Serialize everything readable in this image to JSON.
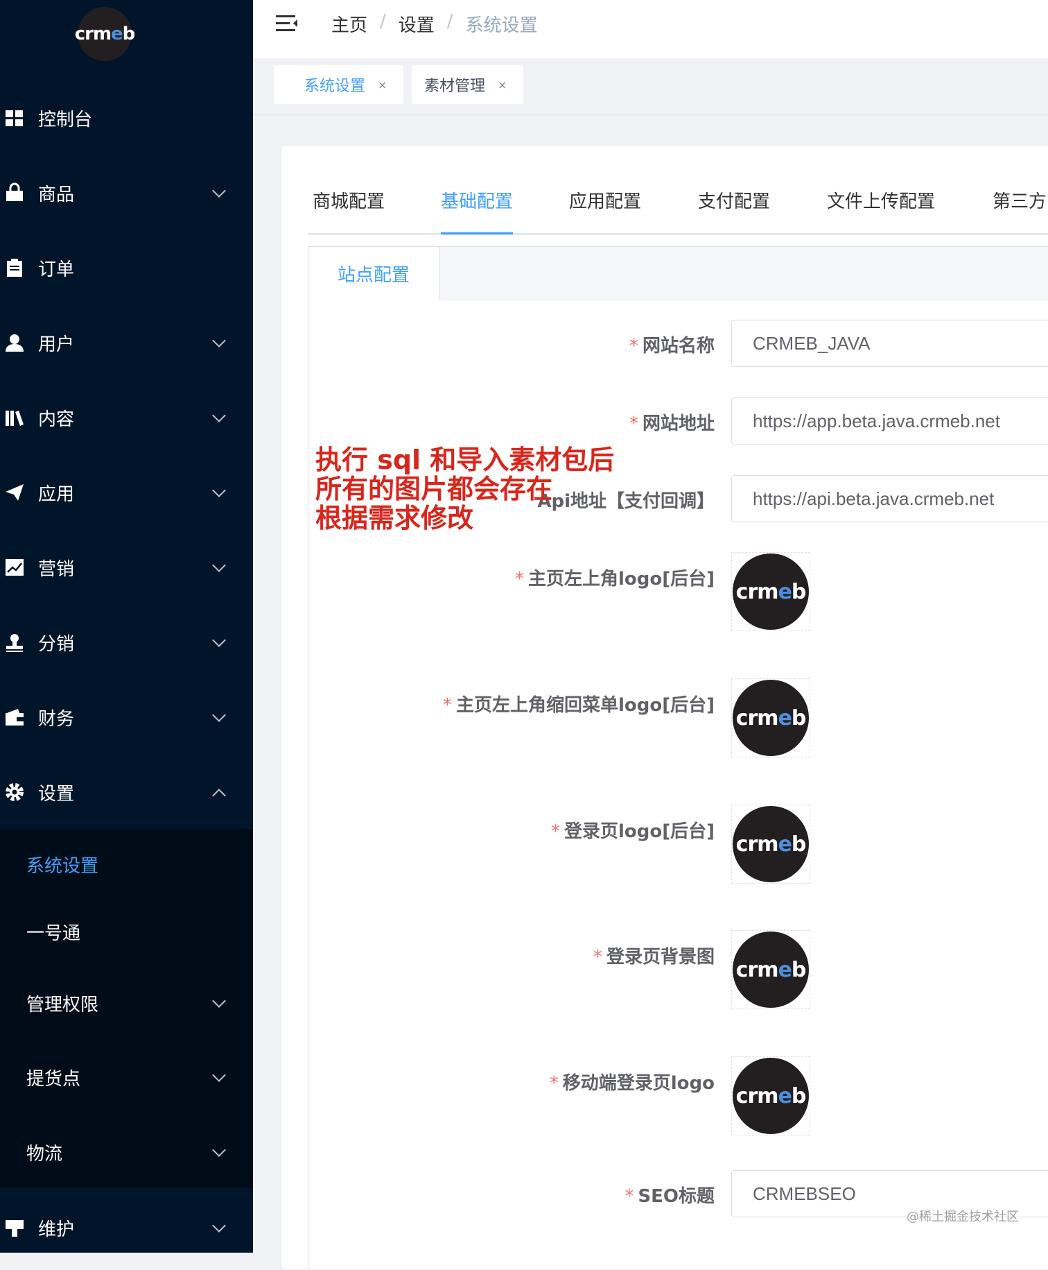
{
  "app": {
    "logo_text": "crmeb"
  },
  "sidebar": {
    "items": [
      {
        "label": "控制台",
        "icon": "dashboard-icon",
        "expandable": false
      },
      {
        "label": "商品",
        "icon": "shopping-bag-icon",
        "expandable": true
      },
      {
        "label": "订单",
        "icon": "clipboard-icon",
        "expandable": false
      },
      {
        "label": "用户",
        "icon": "user-icon",
        "expandable": true
      },
      {
        "label": "内容",
        "icon": "books-icon",
        "expandable": true
      },
      {
        "label": "应用",
        "icon": "paper-plane-icon",
        "expandable": true
      },
      {
        "label": "营销",
        "icon": "chart-icon",
        "expandable": true
      },
      {
        "label": "分销",
        "icon": "stamp-icon",
        "expandable": true
      },
      {
        "label": "财务",
        "icon": "wallet-icon",
        "expandable": true
      },
      {
        "label": "设置",
        "icon": "gear-icon",
        "expandable": true,
        "expanded": true
      }
    ],
    "settings_children": [
      {
        "label": "系统设置",
        "active": true
      },
      {
        "label": "一号通",
        "expandable": false
      },
      {
        "label": "管理权限",
        "expandable": true
      },
      {
        "label": "提货点",
        "expandable": true
      },
      {
        "label": "物流",
        "expandable": true
      }
    ],
    "maintenance": {
      "label": "维护",
      "icon": "tool-icon"
    }
  },
  "header": {
    "breadcrumb": [
      "主页",
      "设置",
      "系统设置"
    ]
  },
  "tags": [
    {
      "label": "系统设置",
      "active": true,
      "close": "×"
    },
    {
      "label": "素材管理",
      "active": false,
      "close": "×"
    }
  ],
  "config_tabs": [
    "商城配置",
    "基础配置",
    "应用配置",
    "支付配置",
    "文件上传配置",
    "第三方"
  ],
  "config_tab_active": "基础配置",
  "sub_tab": "站点配置",
  "form": {
    "site_name": {
      "label": "网站名称",
      "value": "CRMEB_JAVA"
    },
    "site_url": {
      "label": "网站地址",
      "value": "https://app.beta.java.crmeb.net"
    },
    "api_url": {
      "label": "Api地址【支付回调】",
      "value": "https://api.beta.java.crmeb.net"
    },
    "logo_top_left": {
      "label": "主页左上角logo[后台]"
    },
    "logo_collapsed": {
      "label": "主页左上角缩回菜单logo[后台]"
    },
    "login_logo": {
      "label": "登录页logo[后台]"
    },
    "login_bg": {
      "label": "登录页背景图"
    },
    "mobile_login_logo": {
      "label": "移动端登录页logo"
    },
    "seo_title": {
      "label": "SEO标题",
      "value": "CRMEBSEO"
    }
  },
  "annotation": {
    "lines": [
      "执行 sql 和导入素材包后",
      "所有的图片都会存在",
      "根据需求修改"
    ]
  },
  "watermark": "@稀土掘金技术社区",
  "colors": {
    "accent": "#409eff",
    "sidebar_bg": "#001529",
    "required": "#f56c6c",
    "annotation": "#d9261c"
  }
}
